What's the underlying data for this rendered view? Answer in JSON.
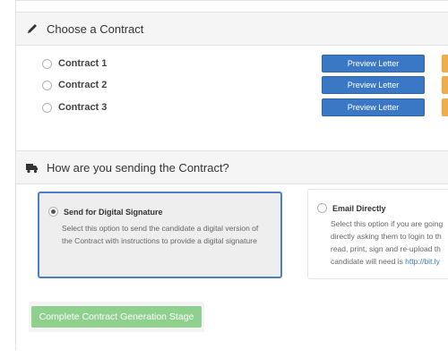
{
  "choose_section": {
    "title": "Choose a Contract",
    "icon": "pen-icon",
    "contracts": [
      {
        "label": "Contract 1",
        "preview_label": "Preview Letter"
      },
      {
        "label": "Contract 2",
        "preview_label": "Preview Letter"
      },
      {
        "label": "Contract 3",
        "preview_label": "Preview Letter"
      }
    ]
  },
  "send_section": {
    "title": "How are you sending the Contract?",
    "icon": "truck-icon",
    "options": [
      {
        "title": "Send for Digital Signature",
        "lines": [
          "Select this option to send the candidate a digital version of",
          "the Contract with instructions to provide a digital signature"
        ],
        "selected": true
      },
      {
        "title": "Email Directly",
        "lines": [
          "Select this option if you are going",
          "directly asking them to login to th",
          "read, print, sign and re-upload th"
        ],
        "last_line_text": "candidate will need is ",
        "last_line_link": "http://bit.ly",
        "selected": false
      }
    ]
  },
  "complete_button": "Complete Contract Generation Stage",
  "colors": {
    "primary": "#3a78c5",
    "warning": "#f0ad4e",
    "success_disabled": "#8fd08f",
    "selected_border": "#4a7fc8"
  }
}
